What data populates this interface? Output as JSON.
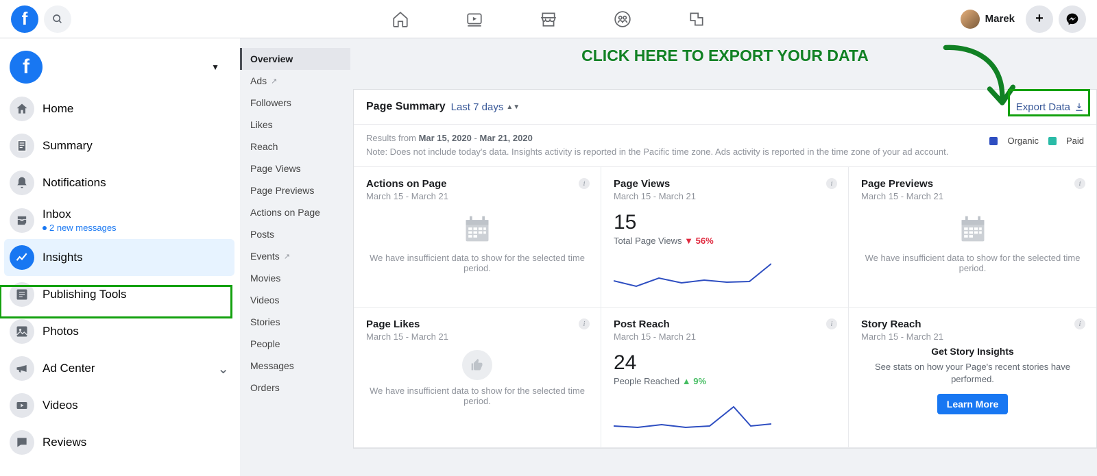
{
  "topbar": {
    "user_name": "Marek"
  },
  "sidebar": {
    "items": [
      {
        "label": "Home"
      },
      {
        "label": "Summary"
      },
      {
        "label": "Notifications"
      },
      {
        "label": "Inbox",
        "sub": "2 new messages"
      },
      {
        "label": "Insights"
      },
      {
        "label": "Publishing Tools"
      },
      {
        "label": "Photos"
      },
      {
        "label": "Ad Center"
      },
      {
        "label": "Videos"
      },
      {
        "label": "Reviews"
      }
    ]
  },
  "subnav": {
    "items": [
      "Overview",
      "Ads",
      "Followers",
      "Likes",
      "Reach",
      "Page Views",
      "Page Previews",
      "Actions on Page",
      "Posts",
      "Events",
      "Movies",
      "Videos",
      "Stories",
      "People",
      "Messages",
      "Orders"
    ]
  },
  "annotation_text": "CLICK HERE TO EXPORT YOUR DATA",
  "summary": {
    "title": "Page Summary",
    "range": "Last 7 days",
    "export_label": "Export Data",
    "results_prefix": "Results from ",
    "date_from": "Mar 15, 2020",
    "date_sep": " - ",
    "date_to": "Mar 21, 2020",
    "note_text": "Note: Does not include today's data. Insights activity is reported in the Pacific time zone. Ads activity is reported in the time zone of your ad account.",
    "legend_organic": "Organic",
    "legend_paid": "Paid"
  },
  "cards": {
    "insufficient_msg": "We have insufficient data to show for the selected time period.",
    "actions": {
      "title": "Actions on Page",
      "date": "March 15 - March 21"
    },
    "views": {
      "title": "Page Views",
      "date": "March 15 - March 21",
      "value": "15",
      "sub": "Total Page Views",
      "delta": "56%"
    },
    "previews": {
      "title": "Page Previews",
      "date": "March 15 - March 21"
    },
    "likes": {
      "title": "Page Likes",
      "date": "March 15 - March 21"
    },
    "reach": {
      "title": "Post Reach",
      "date": "March 15 - March 21",
      "value": "24",
      "sub": "People Reached",
      "delta": "9%"
    },
    "story": {
      "title": "Story Reach",
      "date": "March 15 - March 21",
      "head": "Get Story Insights",
      "txt": "See stats on how your Page's recent stories have performed.",
      "btn": "Learn More"
    }
  },
  "chart_data": [
    {
      "type": "line",
      "card": "Page Views",
      "x": [
        0,
        1,
        2,
        3,
        4,
        5,
        6
      ],
      "values": [
        2.0,
        1.3,
        2.4,
        1.8,
        2.1,
        1.9,
        4.3
      ]
    },
    {
      "type": "line",
      "card": "Post Reach",
      "x": [
        0,
        1,
        2,
        3,
        4,
        5,
        6
      ],
      "values": [
        3.2,
        3.0,
        3.4,
        3.0,
        3.2,
        7.0,
        3.6
      ]
    }
  ],
  "colors": {
    "brand": "#1877f2",
    "organic": "#2e4ec1",
    "paid": "#2abba7",
    "highlight": "#13a10e",
    "delta_down": "#e0293e",
    "delta_up": "#45bd62"
  }
}
